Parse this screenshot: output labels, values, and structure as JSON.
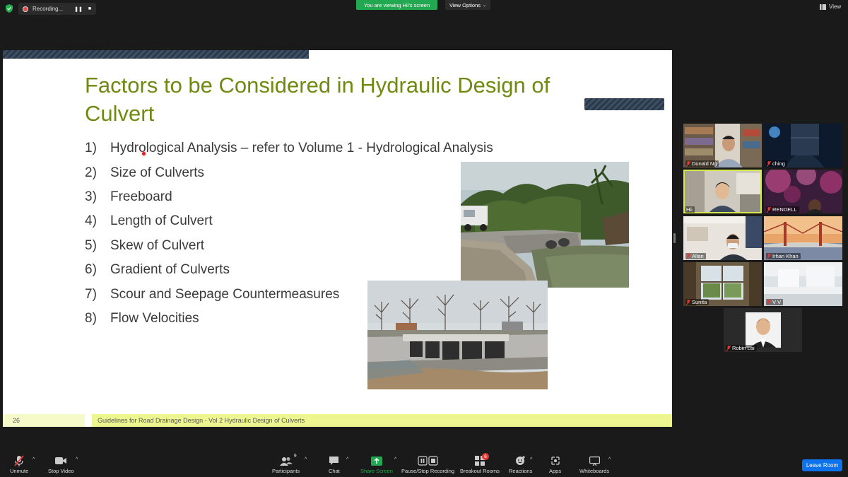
{
  "topbar": {
    "recording_label": "Recording...",
    "viewing_banner": "You are viewing Hii's screen",
    "view_options_label": "View Options",
    "view_label": "View"
  },
  "slide": {
    "title": "Factors to be Considered in Hydraulic Design of Culvert",
    "items": [
      {
        "num": "1)",
        "text": "Hydrological Analysis – refer to Volume 1  - Hydrological Analysis"
      },
      {
        "num": "2)",
        "text": "Size of Culverts"
      },
      {
        "num": "3)",
        "text": "Freeboard"
      },
      {
        "num": "4)",
        "text": "Length of Culvert"
      },
      {
        "num": "5)",
        "text": "Skew of Culvert"
      },
      {
        "num": "6)",
        "text": "Gradient of Culverts"
      },
      {
        "num": "7)",
        "text": "Scour and Seepage Countermeasures"
      },
      {
        "num": "8)",
        "text": "Flow Velocities"
      }
    ],
    "page_number": "26",
    "footer": "Guidelines for Road Drainage Design - Vol 2 Hydraulic Design of Culverts",
    "title_color": "#6f8a10",
    "footer_color": "#eef78f"
  },
  "participants": [
    {
      "name": "Donald Ng"
    },
    {
      "name": "ching"
    },
    {
      "name": "Hii"
    },
    {
      "name": "RENDELL"
    },
    {
      "name": "Allan"
    },
    {
      "name": "Irhan Khan"
    },
    {
      "name": "Sunita"
    },
    {
      "name": "V V"
    },
    {
      "name": "Robin Lai"
    }
  ],
  "toolbar": {
    "unmute": "Unmute",
    "stop_video": "Stop Video",
    "participants": "Participants",
    "participants_count": "9",
    "chat": "Chat",
    "share_screen": "Share Screen",
    "pause_recording": "Pause/Stop Recording",
    "breakout_rooms": "Breakout Rooms",
    "breakout_badge": "6",
    "reactions": "Reactions",
    "apps": "Apps",
    "whiteboards": "Whiteboards",
    "leave": "Leave Room"
  },
  "colors": {
    "share_green": "#21a850",
    "leave_blue": "#0e72ed",
    "active_speaker": "#d7e94a"
  }
}
